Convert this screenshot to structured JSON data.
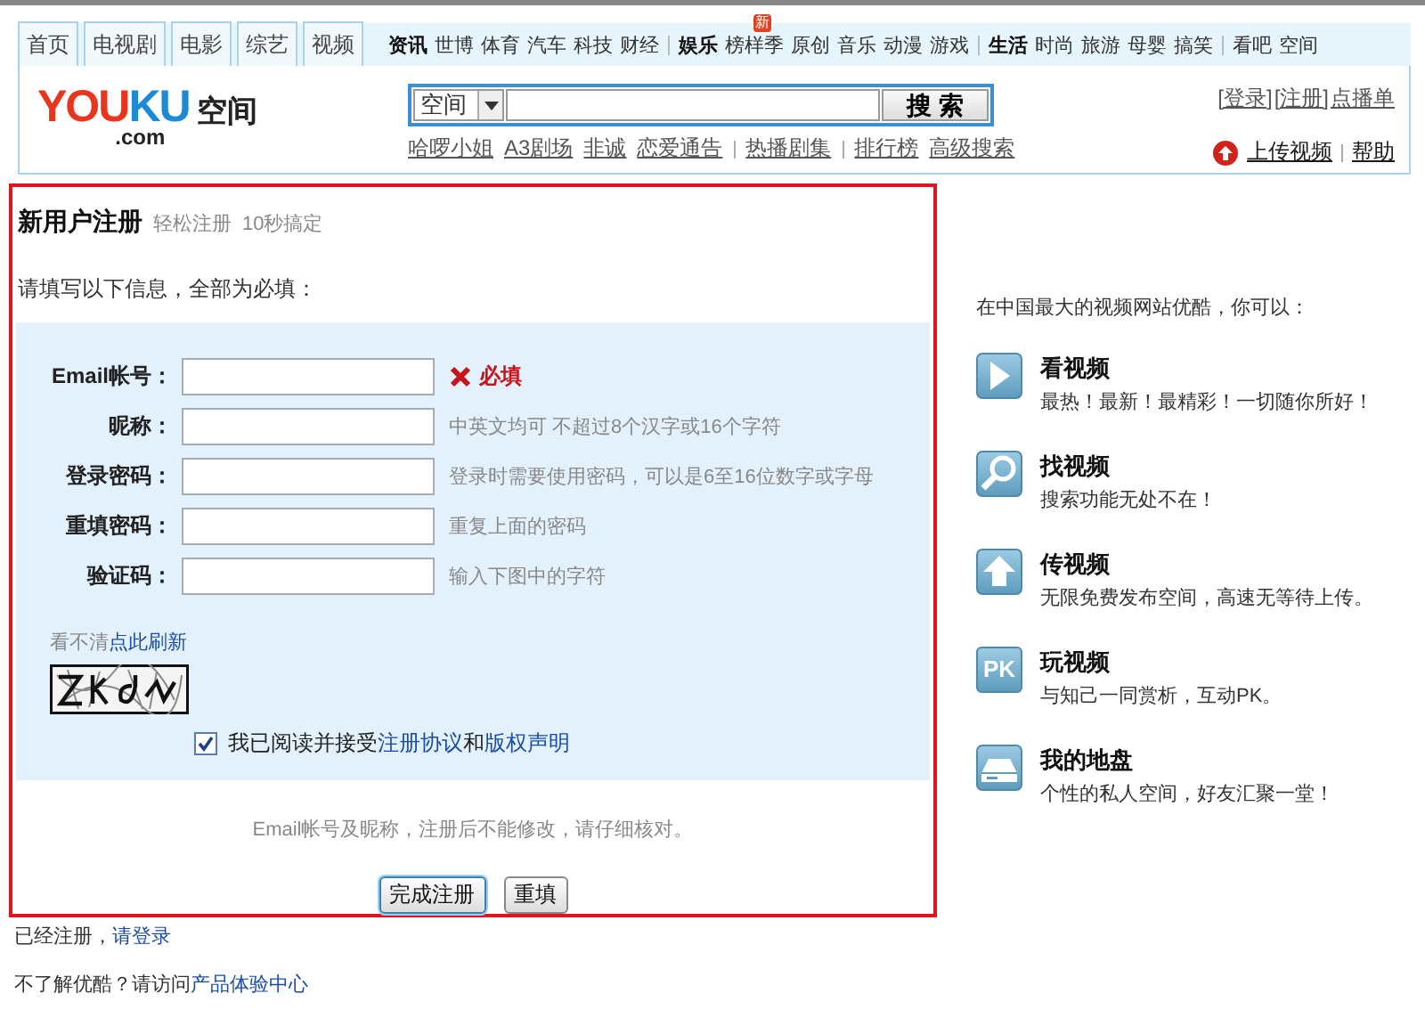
{
  "top_nav": {
    "tabs": [
      {
        "label": "首页",
        "selected": false
      },
      {
        "label": "电视剧",
        "selected": false
      },
      {
        "label": "电影",
        "selected": false
      },
      {
        "label": "综艺",
        "selected": false
      },
      {
        "label": "视频",
        "selected": false
      }
    ],
    "channel_groups": [
      {
        "items": [
          {
            "label": "资讯",
            "kind": "head"
          },
          {
            "label": "世博",
            "kind": "link"
          },
          {
            "label": "体育",
            "kind": "link"
          },
          {
            "label": "汽车",
            "kind": "link"
          },
          {
            "label": "科技",
            "kind": "link"
          },
          {
            "label": "财经",
            "kind": "link"
          }
        ]
      },
      {
        "items": [
          {
            "label": "娱乐",
            "kind": "head"
          },
          {
            "label": "榜样季",
            "kind": "link",
            "badge": "新"
          },
          {
            "label": "原创",
            "kind": "link"
          },
          {
            "label": "音乐",
            "kind": "link"
          },
          {
            "label": "动漫",
            "kind": "link"
          },
          {
            "label": "游戏",
            "kind": "link"
          }
        ]
      },
      {
        "items": [
          {
            "label": "生活",
            "kind": "head"
          },
          {
            "label": "时尚",
            "kind": "link"
          },
          {
            "label": "旅游",
            "kind": "link"
          },
          {
            "label": "母婴",
            "kind": "link"
          },
          {
            "label": "搞笑",
            "kind": "link"
          }
        ]
      },
      {
        "items": [
          {
            "label": "看吧",
            "kind": "link"
          },
          {
            "label": "空间",
            "kind": "link"
          }
        ]
      }
    ]
  },
  "header": {
    "logo": {
      "wordmark": "YOUKU",
      "domain": ".com",
      "product": "空间"
    },
    "search": {
      "scope": "空间",
      "button": "搜 索"
    },
    "hot_link_groups": [
      [
        "哈啰小姐",
        "A3剧场",
        "非诚",
        "恋爱通告"
      ],
      [
        "热播剧集"
      ],
      [
        "排行榜",
        "高级搜索"
      ]
    ],
    "account_links": [
      "[登录]",
      "[注册]",
      "点播单"
    ],
    "upload_link": "上传视频",
    "help_link": "帮助"
  },
  "form": {
    "title": "新用户注册",
    "subtitles": [
      "轻松注册",
      "10秒搞定"
    ],
    "instruction": "请填写以下信息，全部为必填：",
    "fields": [
      {
        "label": "Email帐号：",
        "kind": "error",
        "message": "必填"
      },
      {
        "label": "昵称：",
        "kind": "hint",
        "message": "中英文均可  不超过8个汉字或16个字符"
      },
      {
        "label": "登录密码：",
        "kind": "hint",
        "message": "登录时需要使用密码，可以是6至16位数字或字母"
      },
      {
        "label": "重填密码：",
        "kind": "hint",
        "message": "重复上面的密码"
      },
      {
        "label": "验证码：",
        "kind": "hint",
        "message": "输入下图中的字符"
      }
    ],
    "captcha": {
      "prompt": "看不清",
      "refresh_link": "点此刷新"
    },
    "agreement": {
      "checked": true,
      "parts": [
        {
          "kind": "text",
          "text": "我已阅读并接受"
        },
        {
          "kind": "link",
          "text": "注册协议"
        },
        {
          "kind": "text",
          "text": "和"
        },
        {
          "kind": "link",
          "text": "版权声明"
        }
      ]
    },
    "note": "Email帐号及昵称，注册后不能修改，请仔细核对。",
    "buttons": [
      {
        "label": "完成注册",
        "kind": "primary"
      },
      {
        "label": "重填",
        "kind": "secondary"
      }
    ]
  },
  "footer_lines": [
    {
      "text": "已经注册，",
      "link": "请登录"
    },
    {
      "text": "不了解优酷？请访问",
      "link": "产品体验中心"
    }
  ],
  "side": {
    "intro": "在中国最大的视频网站优酷，你可以：",
    "features": [
      {
        "kind": "play",
        "title": "看视频",
        "description": "最热！最新！最精彩！一切随你所好！"
      },
      {
        "kind": "search",
        "title": "找视频",
        "description": "搜索功能无处不在！"
      },
      {
        "kind": "upload",
        "title": "传视频",
        "description": "无限免费发布空间，高速无等待上传。"
      },
      {
        "kind": "text",
        "icon_text": "PK",
        "title": "玩视频",
        "description": "与知己一同赏析，互动PK。"
      },
      {
        "kind": "drive",
        "title": "我的地盘",
        "description": "个性的私人空间，好友汇聚一堂！"
      }
    ]
  }
}
